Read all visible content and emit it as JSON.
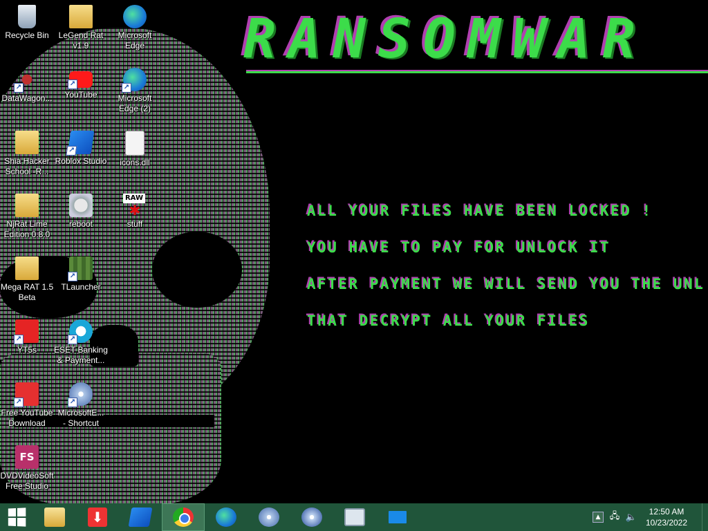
{
  "wallpaper": {
    "title": "RANSOMWAR",
    "lines": [
      "ALL YOUR FILES HAVE BEEN LOCKED !",
      "YOU HAVE TO PAY FOR UNLOCK IT",
      "AFTER PAYMENT WE WILL SEND YOU THE UNL",
      "THAT DECRYPT ALL YOUR FILES"
    ],
    "accent_color": "#3cdc4a",
    "shadow_color": "#b040b0"
  },
  "desktop_icons": [
    {
      "label": "Recycle Bin",
      "icon": "recycle-bin-icon"
    },
    {
      "label": "LeGend Rat\nv1.9",
      "icon": "folder-icon"
    },
    {
      "label": "Microsoft\nEdge",
      "icon": "edge-icon"
    },
    {
      "label": "DataWagon...",
      "icon": "datawagon-icon"
    },
    {
      "label": "YouTube",
      "icon": "youtube-icon"
    },
    {
      "label": "Microsoft\nEdge (2)",
      "icon": "edge-icon"
    },
    {
      "label": "Shia Hacker\nSchool -R...",
      "icon": "folder-icon"
    },
    {
      "label": "Roblox Studio",
      "icon": "roblox-studio-icon"
    },
    {
      "label": "icons.dll",
      "icon": "dll-file-icon"
    },
    {
      "label": "NjRat Lime\nEdition 0.8.0",
      "icon": "folder-icon"
    },
    {
      "label": "reboot",
      "icon": "script-gear-icon"
    },
    {
      "label": "stuff",
      "icon": "raw-image-icon",
      "badge": "RAW"
    },
    {
      "label": "Mega RAT 1.5\nBeta",
      "icon": "folder-icon"
    },
    {
      "label": "TLauncher",
      "icon": "minecraft-icon"
    },
    {
      "label": "YT5s",
      "icon": "yt5s-icon"
    },
    {
      "label": "ESET Banking\n& Payment...",
      "icon": "eset-icon"
    },
    {
      "label": "Free YouTube\nDownload",
      "icon": "download-icon"
    },
    {
      "label": "MicrosoftE...\n- Shortcut",
      "icon": "disc-icon"
    },
    {
      "label": "DVDVideoSoft\nFree Studio",
      "icon": "dvdvideosoft-icon",
      "badge": "FS"
    }
  ],
  "taskbar": {
    "start_label": "Start",
    "pinned": [
      {
        "name": "file-explorer",
        "icon": "file-explorer-icon"
      },
      {
        "name": "downloader",
        "icon": "download-arrow-icon"
      },
      {
        "name": "roblox-studio",
        "icon": "roblox-studio-icon"
      },
      {
        "name": "chrome",
        "icon": "chrome-icon",
        "active": true
      },
      {
        "name": "edge",
        "icon": "edge-icon"
      },
      {
        "name": "disc-app-1",
        "icon": "disc-icon"
      },
      {
        "name": "disc-app-2",
        "icon": "disc-icon"
      },
      {
        "name": "system-monitor",
        "icon": "monitor-icon"
      },
      {
        "name": "display",
        "icon": "display-icon"
      }
    ],
    "tray": {
      "chevron": "▲",
      "time": "12:50 AM",
      "date": "10/23/2022"
    },
    "color": "#20553a"
  }
}
